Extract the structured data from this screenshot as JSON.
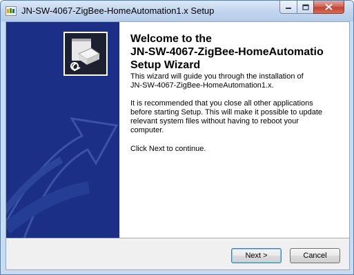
{
  "window": {
    "title": "JN-SW-4067-ZigBee-HomeAutomation1.x Setup",
    "controls": {
      "minimize": "minimize",
      "maximize": "maximize",
      "close": "close"
    }
  },
  "wizard": {
    "heading_line1": "Welcome to the",
    "heading_line2": "JN-SW-4067-ZigBee-HomeAutomatio",
    "heading_line3": "Setup Wizard",
    "paragraph1": "This wizard will guide you through the installation of\nJN-SW-4067-ZigBee-HomeAutomation1.x.",
    "paragraph2": "It is recommended that you close all other applications\nbefore starting Setup. This will make it possible to update\nrelevant system files without having to reboot your\ncomputer.",
    "paragraph3": "Click Next to continue."
  },
  "buttons": {
    "next": "Next >",
    "cancel": "Cancel"
  },
  "colors": {
    "banner": "#1c2f86",
    "title_bar": "#c3d6ee",
    "close_button": "#c04536"
  }
}
